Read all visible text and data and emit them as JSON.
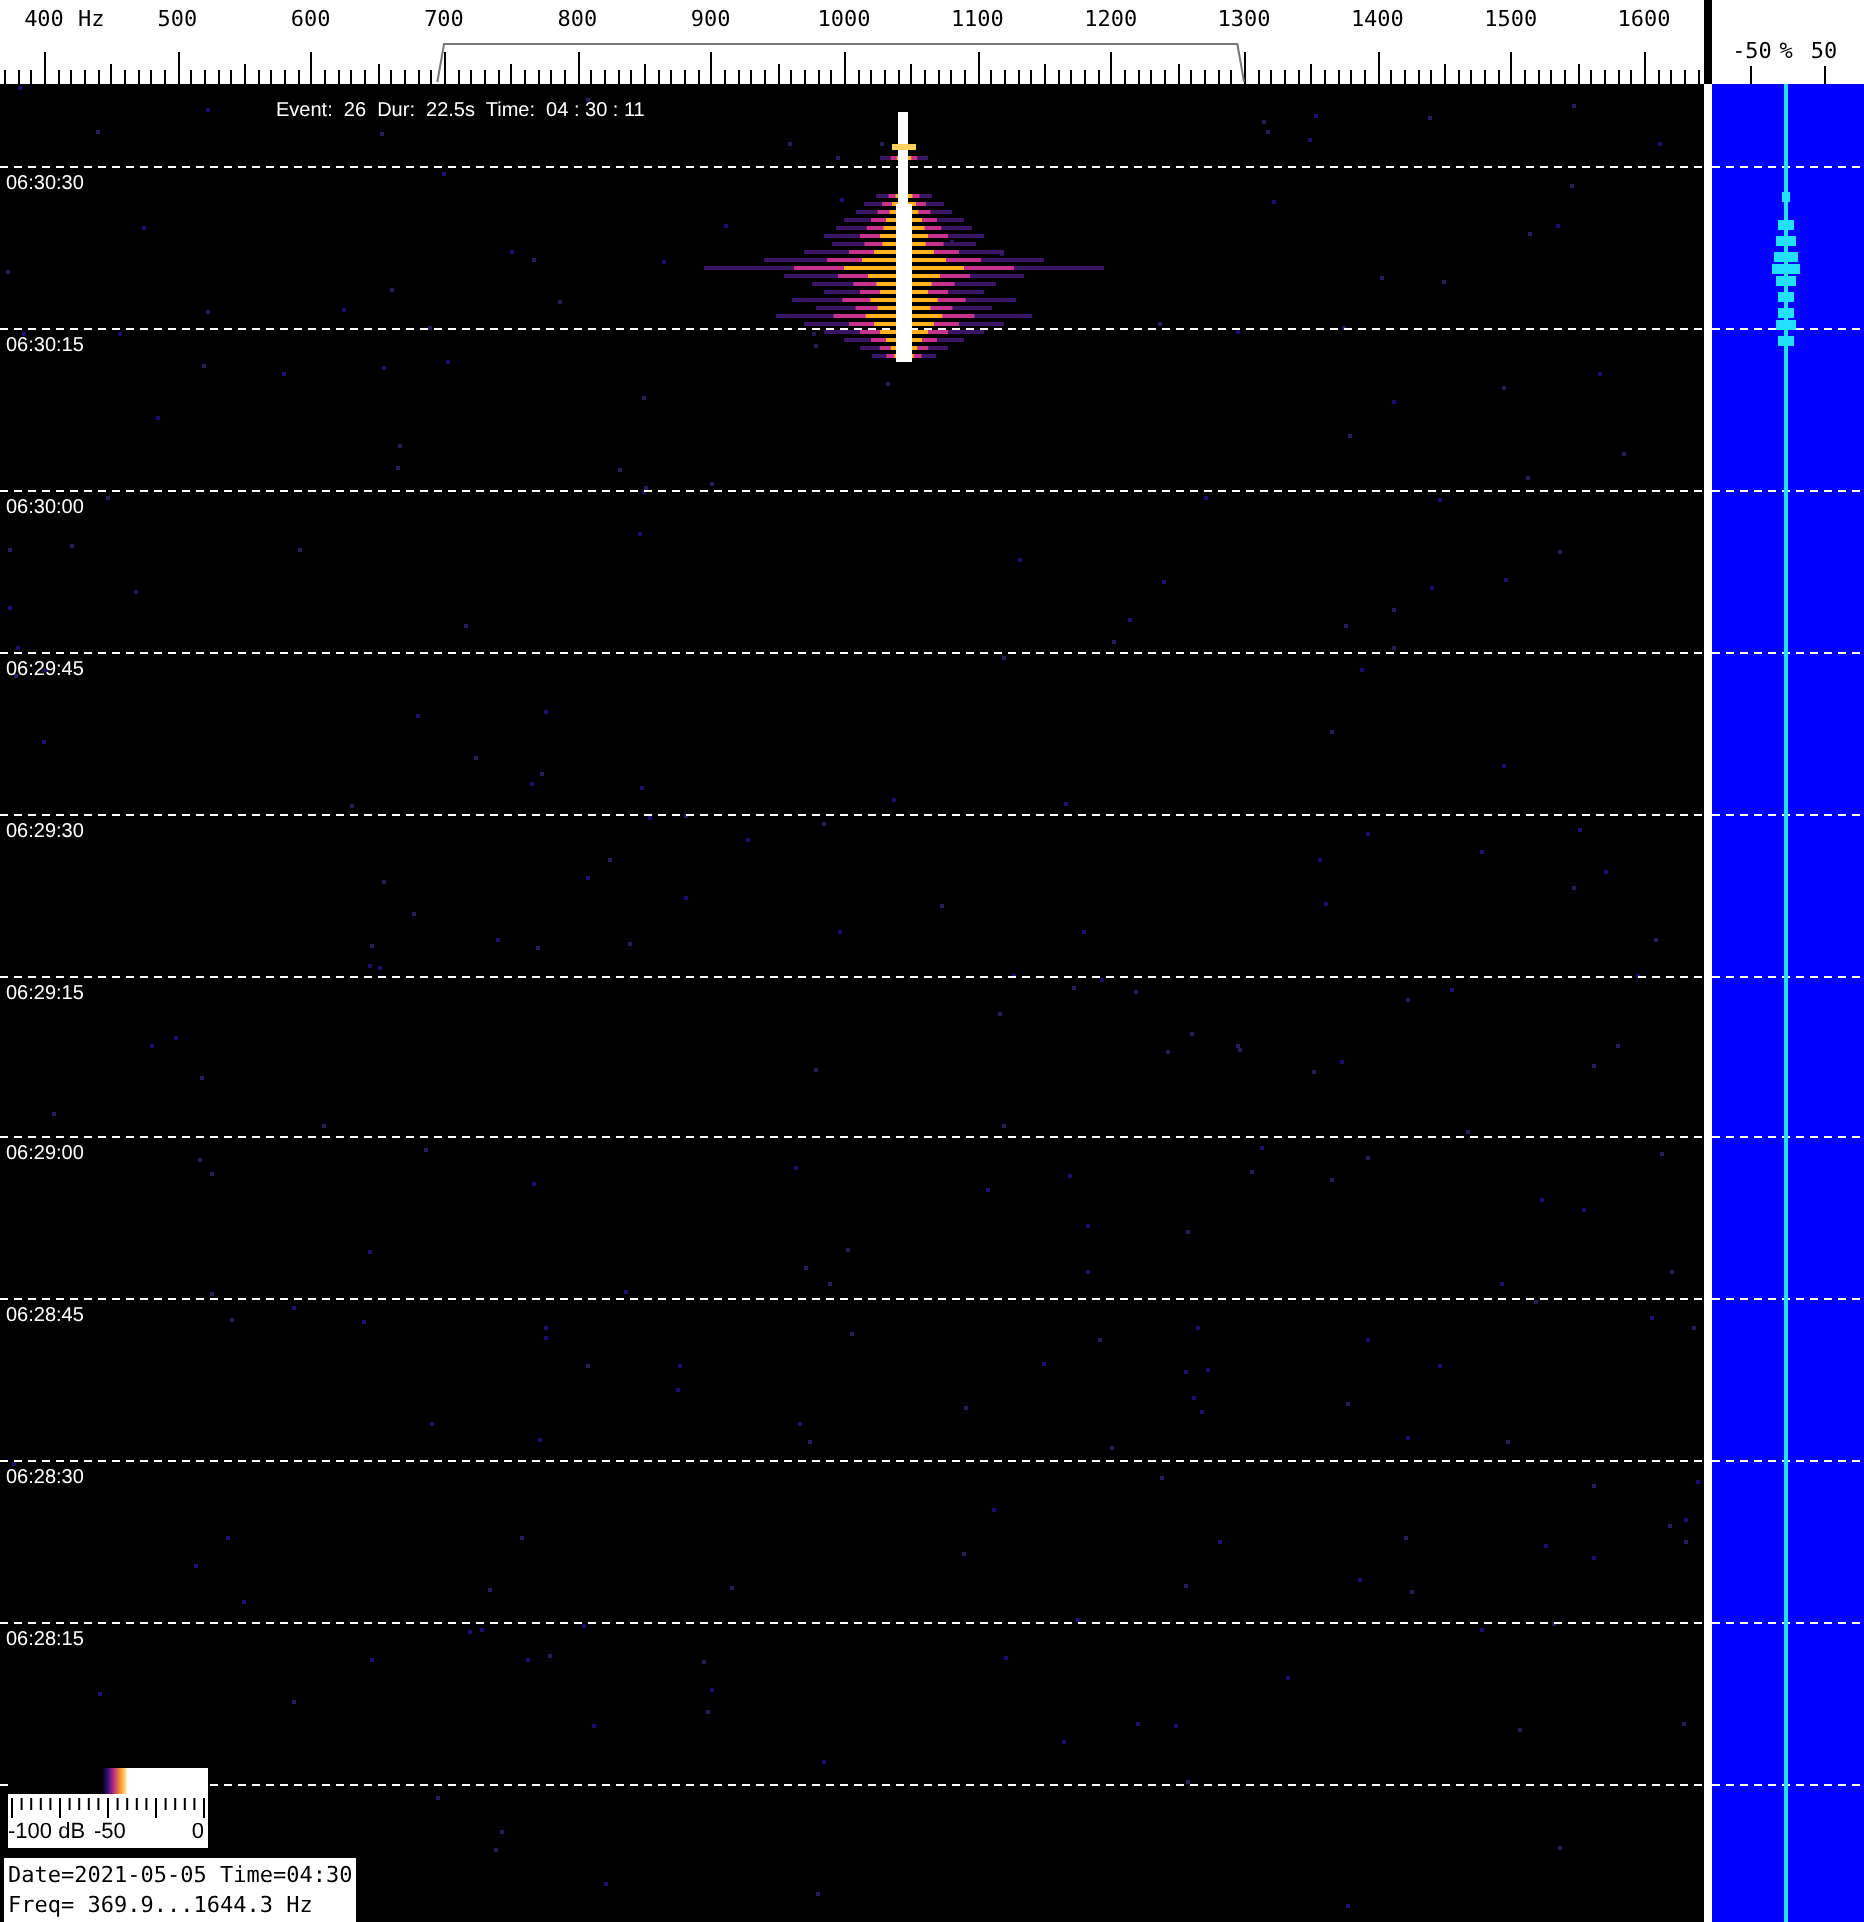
{
  "frequency_axis": {
    "labels": [
      "400",
      "500",
      "600",
      "700",
      "800",
      "900",
      "1000",
      "1100",
      "1200",
      "1300",
      "1400",
      "1500",
      "1600"
    ],
    "unit": "Hz"
  },
  "event_info": "Event:  26  Dur:  22.5s  Time:  04 : 30 : 11",
  "time_labels": [
    "06:30:30",
    "06:30:15",
    "06:30:00",
    "06:29:45",
    "06:29:30",
    "06:29:15",
    "06:29:00",
    "06:28:45",
    "06:28:30",
    "06:28:15"
  ],
  "side_scale": {
    "labels": [
      "-50",
      "%",
      "50"
    ]
  },
  "color_legend": {
    "labels": [
      "-100 dB",
      "-50",
      "0"
    ]
  },
  "info_box": {
    "lines": [
      "Date=2021-05-05 Time=04:30",
      "Freq= 369.9...1644.3 Hz"
    ]
  }
}
